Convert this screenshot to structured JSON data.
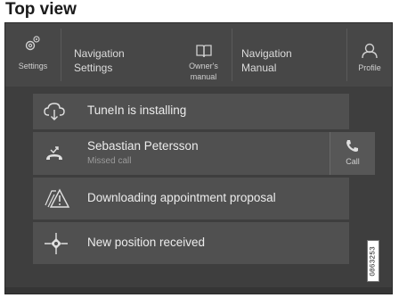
{
  "heading": "Top view",
  "topbar": {
    "settings_label": "Settings",
    "nav_settings_line1": "Navigation",
    "nav_settings_line2": "Settings",
    "owners_manual_line1": "Owner's",
    "owners_manual_line2": "manual",
    "nav_manual_line1": "Navigation",
    "nav_manual_line2": "Manual",
    "profile_label": "Profile"
  },
  "notifications": [
    {
      "title": "TuneIn is installing",
      "icon": "cloud-download-icon"
    },
    {
      "title": "Sebastian Petersson",
      "subtitle": "Missed call",
      "icon": "missed-call-icon",
      "action": "Call"
    },
    {
      "title": "Downloading appointment proposal",
      "icon": "warning-triangle-icon"
    },
    {
      "title": "New position received",
      "icon": "position-crosshair-icon"
    }
  ],
  "image_code": "G063253",
  "colors": {
    "background": "#3e3e3e",
    "row": "#505050",
    "text": "#ececec",
    "subtext": "#9a9a9a"
  }
}
